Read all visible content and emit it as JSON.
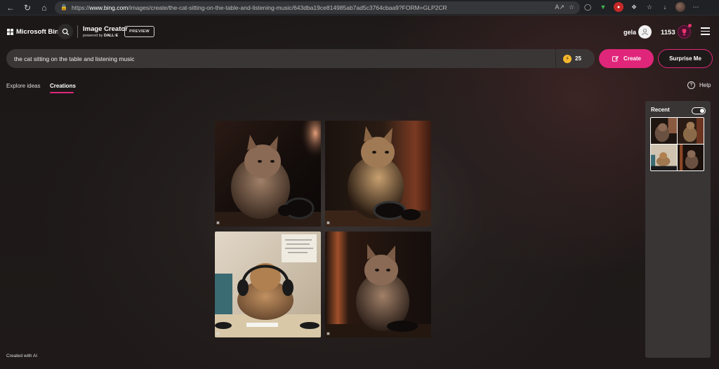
{
  "browser": {
    "url_prefix": "https://",
    "url_host": "www.bing.com",
    "url_rest": "/images/create/the-cat-sitting-on-the-table-and-listening-music/643dba19ce814985ab7ad5c3764cbaa9?FORM=GLP2CR"
  },
  "header": {
    "brand": "Microsoft Bing",
    "product_title": "Image Creator",
    "powered_by": "powered by ",
    "powered_by_brand": "DALL·E",
    "preview_badge": "PREVIEW",
    "user_name": "gela",
    "points": "1153"
  },
  "prompt": {
    "text": "the cat sitting on the table and listening music",
    "boosts": "25",
    "create_label": "Create",
    "surprise_label": "Surprise Me"
  },
  "tabs": [
    {
      "label": "Explore ideas",
      "active": false
    },
    {
      "label": "Creations",
      "active": true
    }
  ],
  "help_label": "Help",
  "recent": {
    "title": "Recent",
    "toggle_on": true
  },
  "images": [
    {
      "name": "cat-with-headphones-1"
    },
    {
      "name": "cat-with-headphones-2"
    },
    {
      "name": "cat-with-headphones-3"
    },
    {
      "name": "cat-with-headphones-4"
    }
  ],
  "footer": "Created with AI",
  "colors": {
    "accent": "#e0267a",
    "background": "#1b1716",
    "panel": "#393535"
  }
}
